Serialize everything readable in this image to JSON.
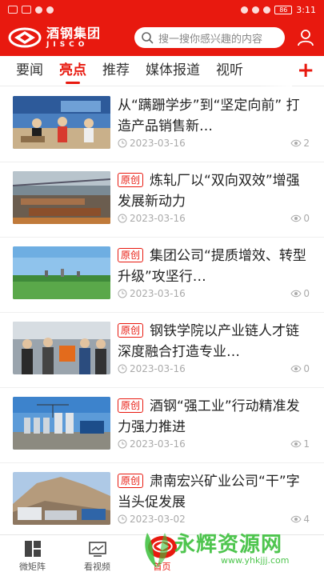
{
  "status_bar": {
    "time": "3:11",
    "battery": "86"
  },
  "header": {
    "logo_cn": "酒钢集团",
    "logo_en": "JISCO",
    "search_placeholder": "搜一搜你感兴趣的内容",
    "icons": {
      "search": "search-icon",
      "user": "user-icon"
    }
  },
  "tabs": [
    {
      "label": "要闻",
      "active": false
    },
    {
      "label": "亮点",
      "active": true
    },
    {
      "label": "推荐",
      "active": false
    },
    {
      "label": "媒体报道",
      "active": false
    },
    {
      "label": "视听",
      "active": false
    }
  ],
  "tab_add": "+",
  "articles": [
    {
      "badge": "",
      "title": "从“蹒跚学步”到“坚定向前” 打造产品销售新…",
      "date": "2023-03-16",
      "views": "2",
      "thumb": "exhibition"
    },
    {
      "badge": "原创",
      "title": "炼轧厂以“双向双效”增强发展新动力",
      "date": "2023-03-16",
      "views": "0",
      "thumb": "factory"
    },
    {
      "badge": "原创",
      "title": "集团公司“提质增效、转型升级”攻坚行…",
      "date": "2023-03-16",
      "views": "0",
      "thumb": "landscape"
    },
    {
      "badge": "原创",
      "title": "钢铁学院以产业链人才链深度融合打造专业…",
      "date": "2023-03-16",
      "views": "0",
      "thumb": "classroom"
    },
    {
      "badge": "原创",
      "title": "酒钢“强工业”行动精准发力强力推进",
      "date": "2023-03-16",
      "views": "1",
      "thumb": "plant"
    },
    {
      "badge": "原创",
      "title": "肃南宏兴矿业公司“干”字当头促发展",
      "date": "2023-03-02",
      "views": "4",
      "thumb": "mine"
    }
  ],
  "bottom_nav": [
    {
      "label": "微矩阵",
      "icon": "grid-icon",
      "active": false
    },
    {
      "label": "看视频",
      "icon": "video-icon",
      "active": false
    },
    {
      "label": "首页",
      "icon": "home-logo-icon",
      "active": true
    },
    {
      "label": "",
      "icon": "blank",
      "active": false
    },
    {
      "label": "",
      "icon": "blank",
      "active": false
    }
  ],
  "watermark": {
    "text": "永辉资源网",
    "url": "www.yhkjjj.com"
  },
  "colors": {
    "brand": "#e8190f",
    "watermark": "#3bbf3b"
  }
}
